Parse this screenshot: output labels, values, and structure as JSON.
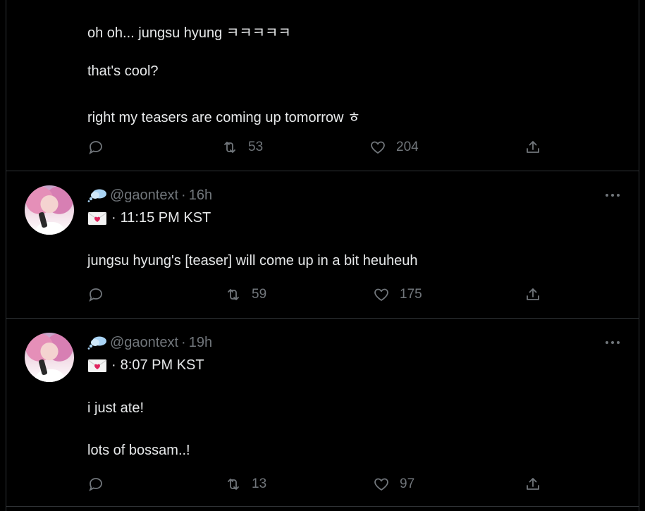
{
  "tweets": [
    {
      "lines": [
        "oh oh... jungsu hyung ㅋㅋㅋㅋㅋ",
        "that's cool?",
        "right my teasers are coming up tomorrow ㅎ"
      ],
      "retweets": "53",
      "likes": "204"
    },
    {
      "handle": "@gaontext",
      "time": "16h",
      "kst": "11:15 PM KST",
      "lines": [
        "jungsu hyung's [teaser] will come up in a bit heuheuh"
      ],
      "retweets": "59",
      "likes": "175"
    },
    {
      "handle": "@gaontext",
      "time": "19h",
      "kst": "8:07 PM KST",
      "lines": [
        "i just ate!",
        "lots of bossam..!"
      ],
      "retweets": "13",
      "likes": "97"
    }
  ],
  "separator": "·",
  "colors": {
    "background": "#000000",
    "text": "#e7e9ea",
    "muted": "#71767b",
    "divider": "#2f3336"
  },
  "icons": [
    "thought-cloud-icon",
    "love-letter-icon",
    "more-icon",
    "reply-icon",
    "retweet-icon",
    "like-icon",
    "share-icon"
  ]
}
